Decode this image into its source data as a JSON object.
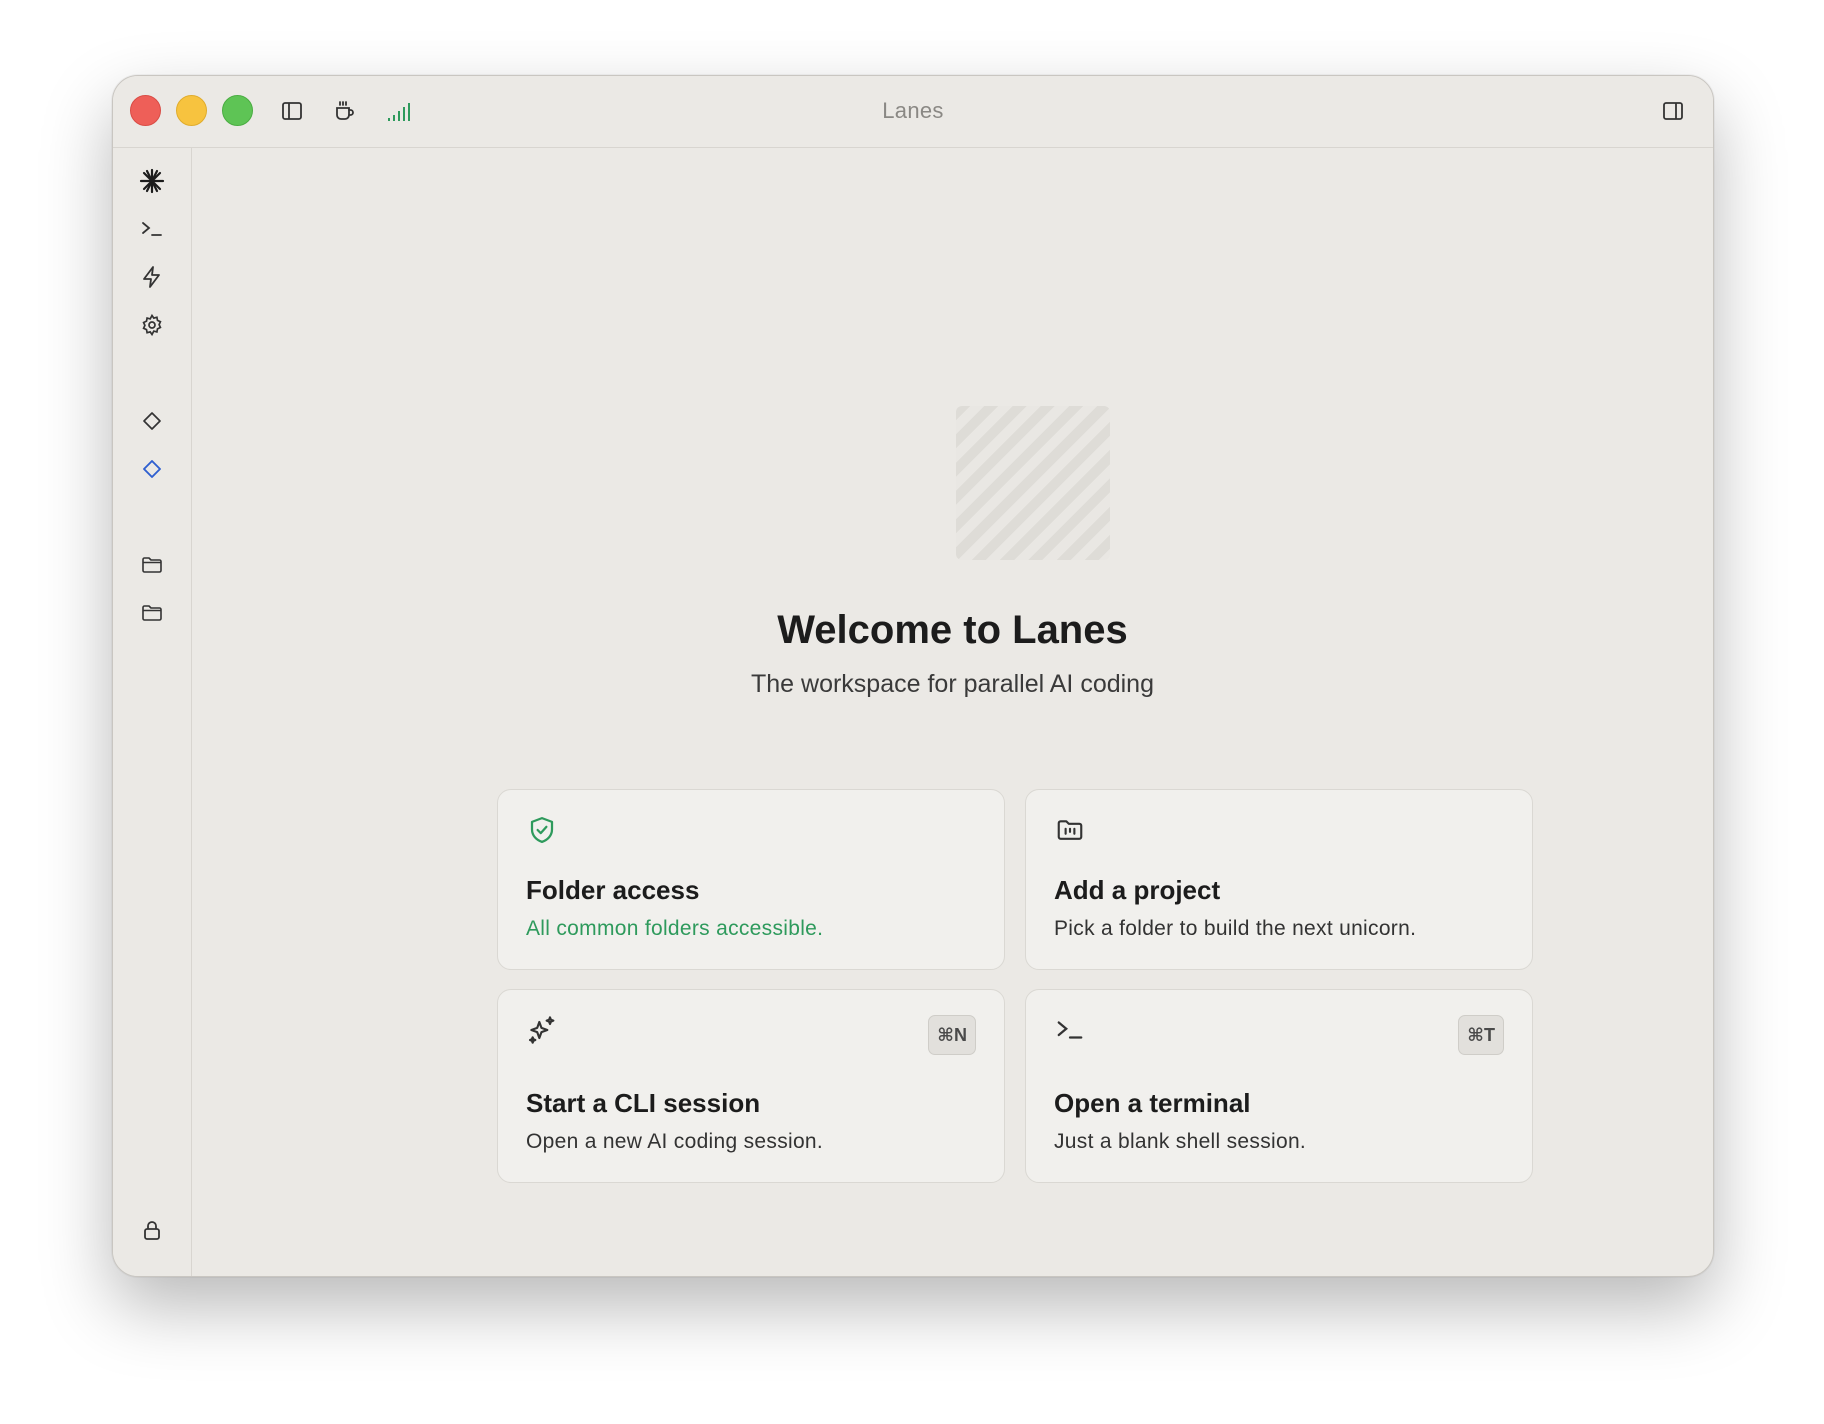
{
  "window": {
    "title": "Lanes"
  },
  "titlebar": {
    "icons": [
      "sidebar-toggle-icon",
      "coffee-icon",
      "signal-bars-icon",
      "right-panel-toggle-icon"
    ],
    "signal_color": "#2e9a5c"
  },
  "sidebar": {
    "items": [
      {
        "icon": "asterisk-icon"
      },
      {
        "icon": "terminal-prompt-icon"
      },
      {
        "icon": "lightning-icon"
      },
      {
        "icon": "gear-icon"
      },
      {
        "icon": "diamond-icon"
      },
      {
        "icon": "diamond-icon",
        "active": true,
        "color": "#2f5fd0"
      },
      {
        "icon": "folder-icon"
      },
      {
        "icon": "folder-icon"
      },
      {
        "icon": "lock-icon"
      }
    ]
  },
  "main": {
    "welcome_title": "Welcome to Lanes",
    "welcome_subtitle": "The workspace for parallel AI coding",
    "cards": [
      {
        "icon": "shield-check-icon",
        "title": "Folder access",
        "description": "All common folders accessible.",
        "description_color": "#2e9a5c"
      },
      {
        "icon": "folder-project-icon",
        "title": "Add a project",
        "description": "Pick a folder to build the next unicorn."
      },
      {
        "icon": "sparkles-icon",
        "title": "Start a CLI session",
        "description": "Open a new AI coding session.",
        "shortcut": "⌘N"
      },
      {
        "icon": "terminal-prompt-icon",
        "title": "Open a terminal",
        "description": "Just a blank shell session.",
        "shortcut": "⌘T"
      }
    ]
  }
}
